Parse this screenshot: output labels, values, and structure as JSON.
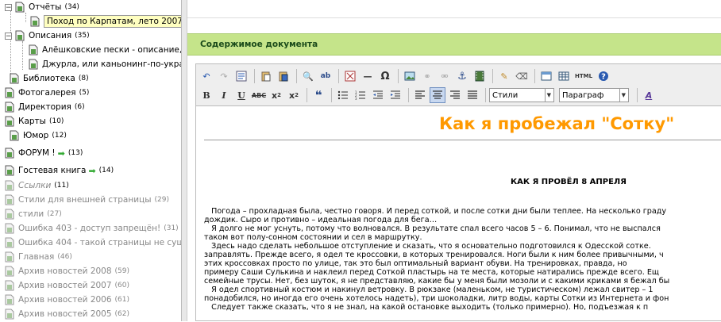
{
  "tree": {
    "items": [
      {
        "label": "Отчёты",
        "count": "(34)"
      },
      {
        "label": "Поход по Карпатам, лето 2007. с"
      },
      {
        "label": "Описания",
        "count": "(35)"
      },
      {
        "label": "Алёшковские пески - описание, "
      },
      {
        "label": "Джурла, или каньонинг-по-украи"
      },
      {
        "label": "Библиотека",
        "count": "(8)"
      },
      {
        "label": "Фотогалерея",
        "count": "(5)"
      },
      {
        "label": "Директория",
        "count": "(6)"
      },
      {
        "label": "Карты",
        "count": "(10)"
      },
      {
        "label": "Юмор",
        "count": "(12)"
      },
      {
        "label": "ФОРУМ !",
        "count": "(13)"
      },
      {
        "label": "Гостевая книга",
        "count": "(14)"
      },
      {
        "label": "Ссылки",
        "count": "(11)"
      },
      {
        "label": "Стили для внешней страницы",
        "count": "(29)"
      },
      {
        "label": "стили",
        "count": "(27)"
      },
      {
        "label": "Ошибка 403 - доступ запрещён!",
        "count": "(31)"
      },
      {
        "label": "Ошибка 404 - такой страницы не суще"
      },
      {
        "label": "Главная",
        "count": "(46)"
      },
      {
        "label": "Архив новостей 2008",
        "count": "(59)"
      },
      {
        "label": "Архив новостей 2007",
        "count": "(60)"
      },
      {
        "label": "Архив новостей 2006",
        "count": "(61)"
      },
      {
        "label": "Архив новостей 2005",
        "count": "(62)"
      }
    ]
  },
  "panel": {
    "header": "Содержимое документа"
  },
  "toolbar": {
    "styles_select": "Стили",
    "format_select": "Параграф",
    "html_label": "HTML"
  },
  "document": {
    "title": "Как я пробежал \"Сотку\"",
    "subtitle": "КАК Я ПРОВЁЛ 8 АПРЕЛЯ",
    "lines": [
      "   Погода – прохладная была, честно говоря. И перед соткой, и после сотки дни были теплее. На несколько граду",
      "дождик. Сыро и противно – идеальная погода для бега…",
      "   Я долго не мог уснуть, потому что волновался. В результате спал всего часов 5 – 6. Понимал, что не выспался",
      "таком вот полу-сонном состоянии и сел в маршрутку.",
      "   Здесь надо сделать небольшое отступление и сказать, что я основательно подготовился к Одесской соткe.",
      "заправлять. Прежде всего, я одел те кроссовки, в которых тренировался. Ноги были к ним более привычными, ч",
      "этих кроссовках просто по улице, так это был оптимальный вариант обуви. На тренировках, правда, но",
      "примеру Саши Сулькина и наклеил перед Соткой пластырь на те места, которые натирались прежде всего. Ещ",
      "семейные трусы. Нет, без шуток, я не представляю, какие бы у меня были мозоли и с какими криками я бежал бы",
      "   Я одел спортивный костюм и накинул ветровку. В рюкзаке (маленьком, не туристическом) лежал свитер – 1",
      "понадобился, но иногда его очень хотелось надеть), три шоколадки, литр воды, карты Сотки из Интернета и фон",
      "   Следует также сказать, что я не знал, на какой остановке выходить (только примерно). Но, подъезжая к п"
    ]
  }
}
